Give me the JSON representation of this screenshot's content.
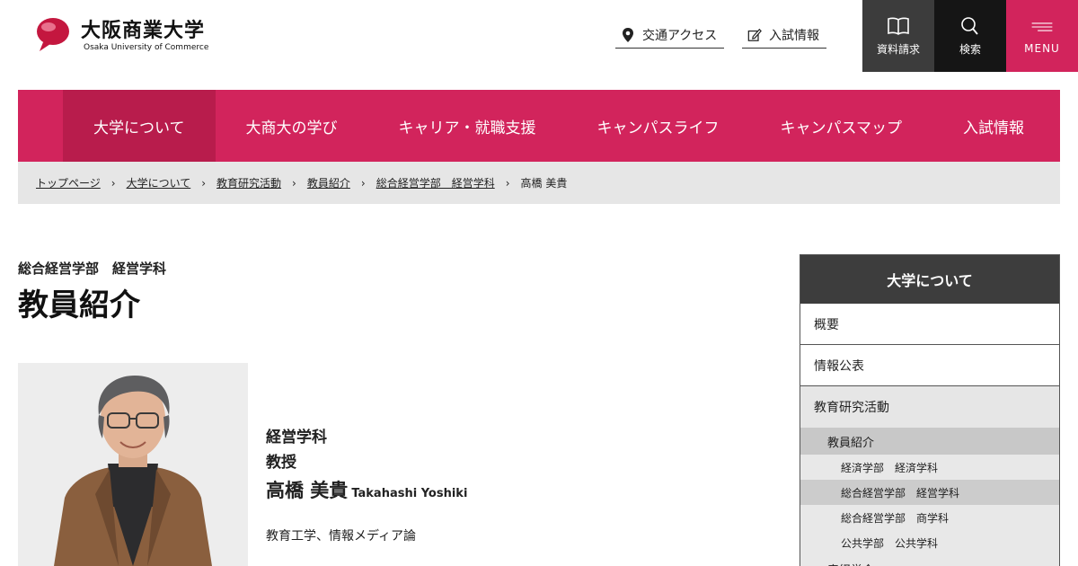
{
  "header": {
    "logo_ja": "大阪商業大学",
    "logo_en": "Osaka University of Commerce",
    "access_label": "交通アクセス",
    "admission_label": "入試情報",
    "docs_label": "資料請求",
    "search_label": "検索",
    "menu_label": "MENU"
  },
  "gnav": {
    "items": [
      "大学について",
      "大商大の学び",
      "キャリア・就職支援",
      "キャンパスライフ",
      "キャンパスマップ",
      "入試情報"
    ],
    "active_index": 0
  },
  "breadcrumb": {
    "items": [
      "トップページ",
      "大学について",
      "教育研究活動",
      "教員紹介",
      "総合経営学部　経営学科",
      "高橋 美貴"
    ],
    "separator": "›"
  },
  "main": {
    "subtitle": "総合経営学部　経営学科",
    "title": "教員紹介",
    "profile": {
      "department": "経営学科",
      "rank": "教授",
      "name_ja": "高橋 美貴",
      "name_en": "Takahashi Yoshiki",
      "field": "教育工学、情報メディア論"
    }
  },
  "side_menu": {
    "heading": "大学について",
    "items": [
      "概要",
      "情報公表",
      "教育研究活動"
    ],
    "sub_heading": "教員紹介",
    "sub_items": [
      "経済学部　経済学科",
      "総合経営学部　経営学科",
      "総合経営学部　商学科",
      "公共学部　公共学科"
    ],
    "current_sub_index": 1,
    "next_heading": "産経学会"
  },
  "colors": {
    "brand": "#d2245c",
    "brand_dark": "#b81c4c",
    "dark_gray": "#3c3c3c",
    "breadcrumb_bg": "#e6e6e6"
  }
}
